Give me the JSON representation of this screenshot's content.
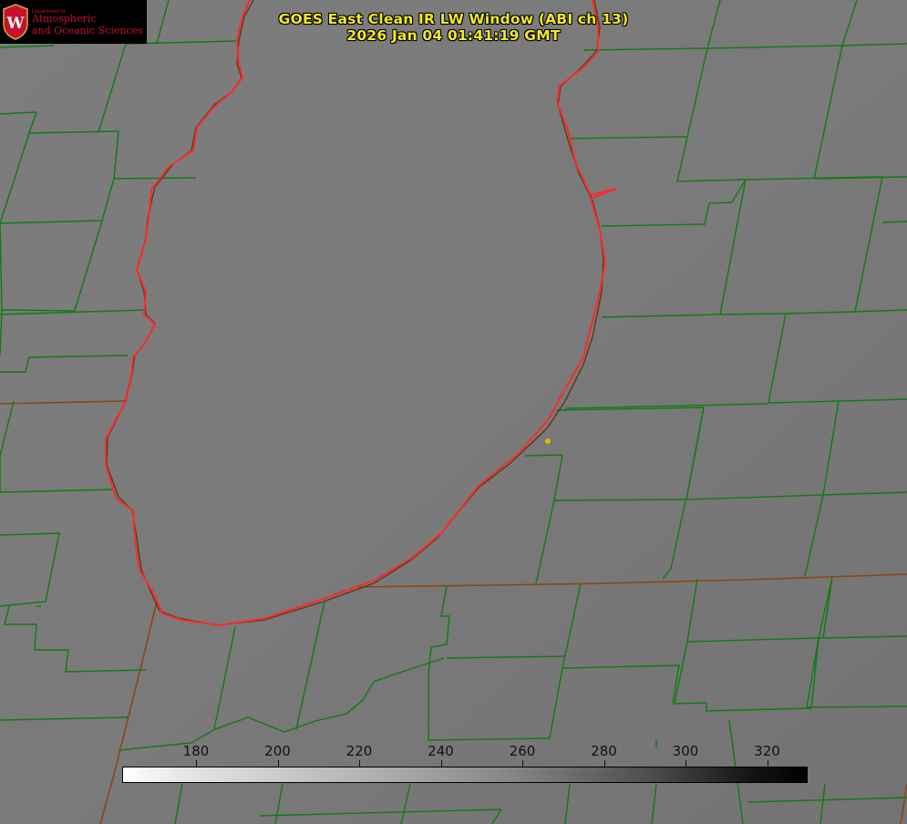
{
  "header": {
    "title_line1": "GOES East Clean IR LW Window (ABI ch 13)",
    "title_line2": "2026 Jan 04 01:41:19 GMT"
  },
  "logo": {
    "department": "Department of",
    "line1": "Atmospheric",
    "line2": "and Oceanic Sciences",
    "crest_letter": "W",
    "color": "#c8102e"
  },
  "colorbar": {
    "ticks": [
      "180",
      "200",
      "220",
      "240",
      "260",
      "280",
      "300",
      "320"
    ],
    "gradient": "white-to-black"
  },
  "colors": {
    "title": "#f2e829",
    "county_lines": "#117a11",
    "state_lines": "#8b4513",
    "lake_outline": "#ff2a2a",
    "marker": "#d8c000",
    "background": "#7a7a7a"
  },
  "map": {
    "feature": "lake-outline",
    "marker_icon": "dot-icon"
  }
}
